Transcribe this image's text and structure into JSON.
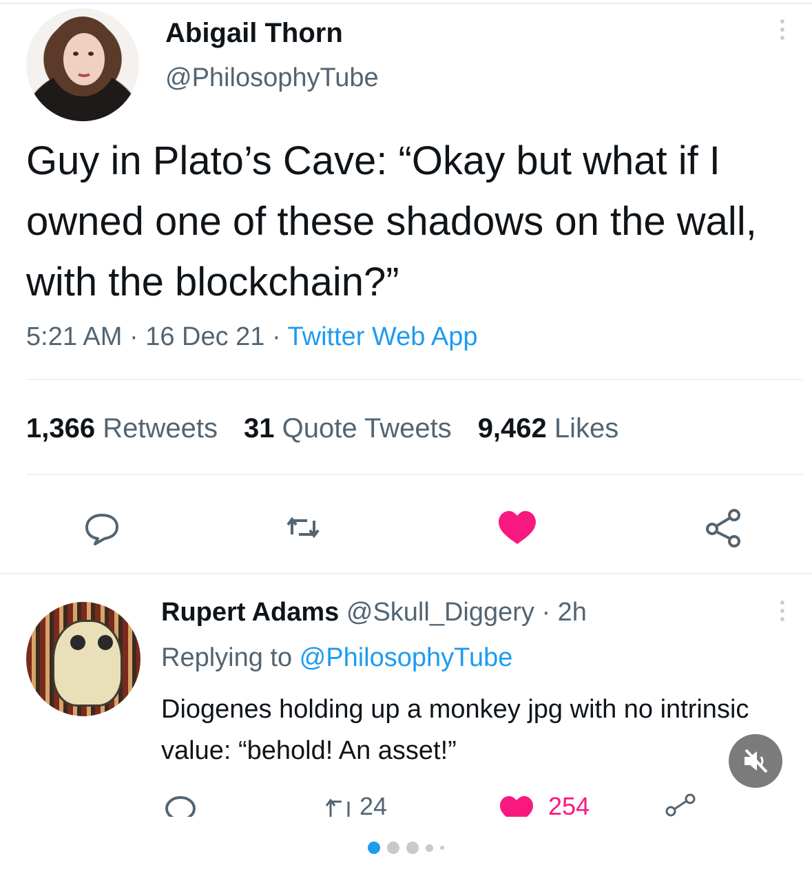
{
  "tweet": {
    "author_name": "Abigail Thorn",
    "author_handle": "@PhilosophyTube",
    "text": "Guy in Plato’s Cave: “Okay but what if I owned one of these shadows on the wall, with the blockchain?”",
    "time": "5:21 AM",
    "sep1": " · ",
    "date": "16 Dec 21",
    "sep2": " · ",
    "source": "Twitter Web App",
    "retweets_count": "1,366",
    "retweets_label": "Retweets",
    "quotes_count": "31",
    "quotes_label": "Quote Tweets",
    "likes_count": "9,462",
    "likes_label": "Likes"
  },
  "reply": {
    "name": "Rupert Adams",
    "handle": "@Skull_Diggery · 2h",
    "replying_prefix": "Replying to ",
    "replying_to": "@PhilosophyTube",
    "text": "Diogenes holding up a monkey jpg with no intrinsic value: “behold! An asset!”",
    "retweets": "24",
    "likes": "254"
  },
  "icons": {
    "reply": "reply-bubble-icon",
    "retweet": "retweet-icon",
    "like": "heart-icon",
    "share": "share-icon",
    "mute": "muted-speaker-icon"
  },
  "colors": {
    "like_pink": "#f91880",
    "link_blue": "#1d9bf0",
    "carousel_active": "#1d9bf0"
  },
  "carousel": {
    "total": 5,
    "active_index": 0
  }
}
